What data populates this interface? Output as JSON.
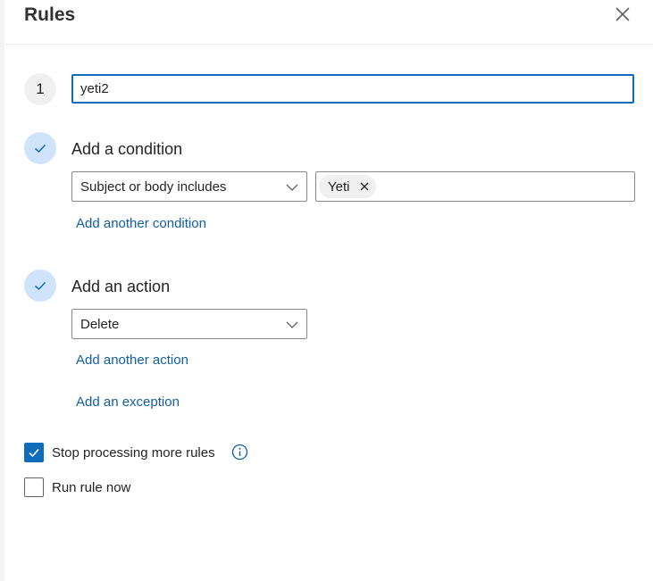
{
  "header": {
    "title": "Rules",
    "close_icon": "close-icon"
  },
  "rule_name": {
    "step_number": "1",
    "value": "yeti2"
  },
  "condition": {
    "heading": "Add a condition",
    "dropdown_value": "Subject or body includes",
    "tags": [
      "Yeti"
    ],
    "add_another_label": "Add another condition"
  },
  "action": {
    "heading": "Add an action",
    "dropdown_value": "Delete",
    "add_another_label": "Add another action"
  },
  "exception": {
    "add_label": "Add an exception"
  },
  "options": {
    "stop_processing": {
      "label": "Stop processing more rules",
      "checked": true
    },
    "run_now": {
      "label": "Run rule now",
      "checked": false
    }
  },
  "colors": {
    "accent": "#0f6cbd",
    "link": "#115ea3",
    "check_circle": "#cfe4fa"
  }
}
